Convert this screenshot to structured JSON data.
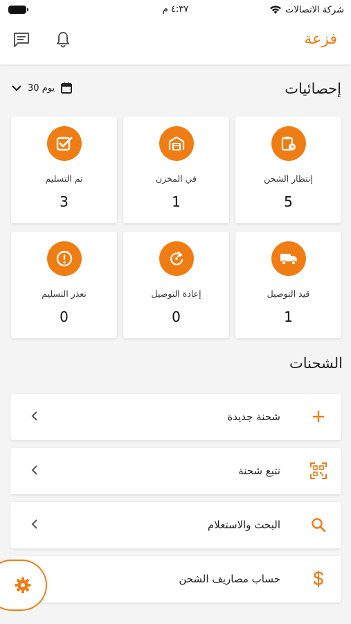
{
  "status_bar": {
    "carrier": "شركة الاتصالات",
    "time": "٤:٣٧ م"
  },
  "app_bar": {
    "brand": "فزعة",
    "icons": [
      "chat-icon",
      "bell-icon"
    ]
  },
  "stats": {
    "title": "إحصائيات",
    "range_label": "30 يوم",
    "cards": [
      {
        "label": "إنتظار الشحن",
        "value": "5",
        "icon": "clipboard-clock-icon"
      },
      {
        "label": "في المخزن",
        "value": "1",
        "icon": "warehouse-icon"
      },
      {
        "label": "تم التسليم",
        "value": "3",
        "icon": "checkbox-icon"
      },
      {
        "label": "قيد التوصيل",
        "value": "1",
        "icon": "truck-icon"
      },
      {
        "label": "إعادة التوصيل",
        "value": "0",
        "icon": "redo-icon"
      },
      {
        "label": "تعذر التسليم",
        "value": "0",
        "icon": "alert-icon"
      }
    ]
  },
  "shipments": {
    "title": "الشحنات",
    "items": [
      {
        "label": "شحنة جديدة",
        "icon": "plus-icon"
      },
      {
        "label": "تتبع شحنة",
        "icon": "qr-scan-icon"
      },
      {
        "label": "البحث والاستعلام",
        "icon": "search-icon"
      },
      {
        "label": "حساب مصاريف الشحن",
        "icon": "dollar-icon"
      }
    ]
  },
  "colors": {
    "accent": "#ef7d14",
    "background": "#f4f4f4",
    "card": "#ffffff"
  }
}
